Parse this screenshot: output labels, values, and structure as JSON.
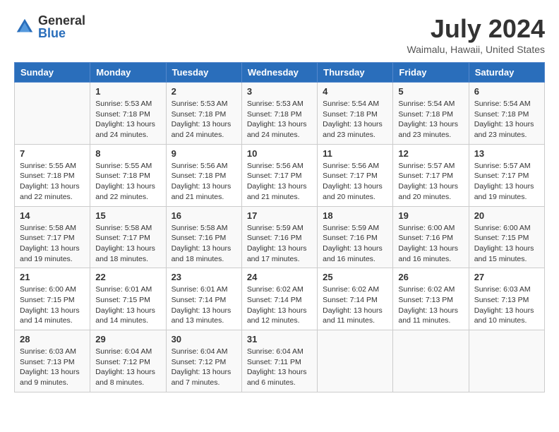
{
  "header": {
    "logo_general": "General",
    "logo_blue": "Blue",
    "month_year": "July 2024",
    "location": "Waimalu, Hawaii, United States"
  },
  "days_of_week": [
    "Sunday",
    "Monday",
    "Tuesday",
    "Wednesday",
    "Thursday",
    "Friday",
    "Saturday"
  ],
  "weeks": [
    [
      {
        "num": "",
        "sunrise": "",
        "sunset": "",
        "daylight": ""
      },
      {
        "num": "1",
        "sunrise": "Sunrise: 5:53 AM",
        "sunset": "Sunset: 7:18 PM",
        "daylight": "Daylight: 13 hours and 24 minutes."
      },
      {
        "num": "2",
        "sunrise": "Sunrise: 5:53 AM",
        "sunset": "Sunset: 7:18 PM",
        "daylight": "Daylight: 13 hours and 24 minutes."
      },
      {
        "num": "3",
        "sunrise": "Sunrise: 5:53 AM",
        "sunset": "Sunset: 7:18 PM",
        "daylight": "Daylight: 13 hours and 24 minutes."
      },
      {
        "num": "4",
        "sunrise": "Sunrise: 5:54 AM",
        "sunset": "Sunset: 7:18 PM",
        "daylight": "Daylight: 13 hours and 23 minutes."
      },
      {
        "num": "5",
        "sunrise": "Sunrise: 5:54 AM",
        "sunset": "Sunset: 7:18 PM",
        "daylight": "Daylight: 13 hours and 23 minutes."
      },
      {
        "num": "6",
        "sunrise": "Sunrise: 5:54 AM",
        "sunset": "Sunset: 7:18 PM",
        "daylight": "Daylight: 13 hours and 23 minutes."
      }
    ],
    [
      {
        "num": "7",
        "sunrise": "Sunrise: 5:55 AM",
        "sunset": "Sunset: 7:18 PM",
        "daylight": "Daylight: 13 hours and 22 minutes."
      },
      {
        "num": "8",
        "sunrise": "Sunrise: 5:55 AM",
        "sunset": "Sunset: 7:18 PM",
        "daylight": "Daylight: 13 hours and 22 minutes."
      },
      {
        "num": "9",
        "sunrise": "Sunrise: 5:56 AM",
        "sunset": "Sunset: 7:18 PM",
        "daylight": "Daylight: 13 hours and 21 minutes."
      },
      {
        "num": "10",
        "sunrise": "Sunrise: 5:56 AM",
        "sunset": "Sunset: 7:17 PM",
        "daylight": "Daylight: 13 hours and 21 minutes."
      },
      {
        "num": "11",
        "sunrise": "Sunrise: 5:56 AM",
        "sunset": "Sunset: 7:17 PM",
        "daylight": "Daylight: 13 hours and 20 minutes."
      },
      {
        "num": "12",
        "sunrise": "Sunrise: 5:57 AM",
        "sunset": "Sunset: 7:17 PM",
        "daylight": "Daylight: 13 hours and 20 minutes."
      },
      {
        "num": "13",
        "sunrise": "Sunrise: 5:57 AM",
        "sunset": "Sunset: 7:17 PM",
        "daylight": "Daylight: 13 hours and 19 minutes."
      }
    ],
    [
      {
        "num": "14",
        "sunrise": "Sunrise: 5:58 AM",
        "sunset": "Sunset: 7:17 PM",
        "daylight": "Daylight: 13 hours and 19 minutes."
      },
      {
        "num": "15",
        "sunrise": "Sunrise: 5:58 AM",
        "sunset": "Sunset: 7:17 PM",
        "daylight": "Daylight: 13 hours and 18 minutes."
      },
      {
        "num": "16",
        "sunrise": "Sunrise: 5:58 AM",
        "sunset": "Sunset: 7:16 PM",
        "daylight": "Daylight: 13 hours and 18 minutes."
      },
      {
        "num": "17",
        "sunrise": "Sunrise: 5:59 AM",
        "sunset": "Sunset: 7:16 PM",
        "daylight": "Daylight: 13 hours and 17 minutes."
      },
      {
        "num": "18",
        "sunrise": "Sunrise: 5:59 AM",
        "sunset": "Sunset: 7:16 PM",
        "daylight": "Daylight: 13 hours and 16 minutes."
      },
      {
        "num": "19",
        "sunrise": "Sunrise: 6:00 AM",
        "sunset": "Sunset: 7:16 PM",
        "daylight": "Daylight: 13 hours and 16 minutes."
      },
      {
        "num": "20",
        "sunrise": "Sunrise: 6:00 AM",
        "sunset": "Sunset: 7:15 PM",
        "daylight": "Daylight: 13 hours and 15 minutes."
      }
    ],
    [
      {
        "num": "21",
        "sunrise": "Sunrise: 6:00 AM",
        "sunset": "Sunset: 7:15 PM",
        "daylight": "Daylight: 13 hours and 14 minutes."
      },
      {
        "num": "22",
        "sunrise": "Sunrise: 6:01 AM",
        "sunset": "Sunset: 7:15 PM",
        "daylight": "Daylight: 13 hours and 14 minutes."
      },
      {
        "num": "23",
        "sunrise": "Sunrise: 6:01 AM",
        "sunset": "Sunset: 7:14 PM",
        "daylight": "Daylight: 13 hours and 13 minutes."
      },
      {
        "num": "24",
        "sunrise": "Sunrise: 6:02 AM",
        "sunset": "Sunset: 7:14 PM",
        "daylight": "Daylight: 13 hours and 12 minutes."
      },
      {
        "num": "25",
        "sunrise": "Sunrise: 6:02 AM",
        "sunset": "Sunset: 7:14 PM",
        "daylight": "Daylight: 13 hours and 11 minutes."
      },
      {
        "num": "26",
        "sunrise": "Sunrise: 6:02 AM",
        "sunset": "Sunset: 7:13 PM",
        "daylight": "Daylight: 13 hours and 11 minutes."
      },
      {
        "num": "27",
        "sunrise": "Sunrise: 6:03 AM",
        "sunset": "Sunset: 7:13 PM",
        "daylight": "Daylight: 13 hours and 10 minutes."
      }
    ],
    [
      {
        "num": "28",
        "sunrise": "Sunrise: 6:03 AM",
        "sunset": "Sunset: 7:13 PM",
        "daylight": "Daylight: 13 hours and 9 minutes."
      },
      {
        "num": "29",
        "sunrise": "Sunrise: 6:04 AM",
        "sunset": "Sunset: 7:12 PM",
        "daylight": "Daylight: 13 hours and 8 minutes."
      },
      {
        "num": "30",
        "sunrise": "Sunrise: 6:04 AM",
        "sunset": "Sunset: 7:12 PM",
        "daylight": "Daylight: 13 hours and 7 minutes."
      },
      {
        "num": "31",
        "sunrise": "Sunrise: 6:04 AM",
        "sunset": "Sunset: 7:11 PM",
        "daylight": "Daylight: 13 hours and 6 minutes."
      },
      {
        "num": "",
        "sunrise": "",
        "sunset": "",
        "daylight": ""
      },
      {
        "num": "",
        "sunrise": "",
        "sunset": "",
        "daylight": ""
      },
      {
        "num": "",
        "sunrise": "",
        "sunset": "",
        "daylight": ""
      }
    ]
  ]
}
